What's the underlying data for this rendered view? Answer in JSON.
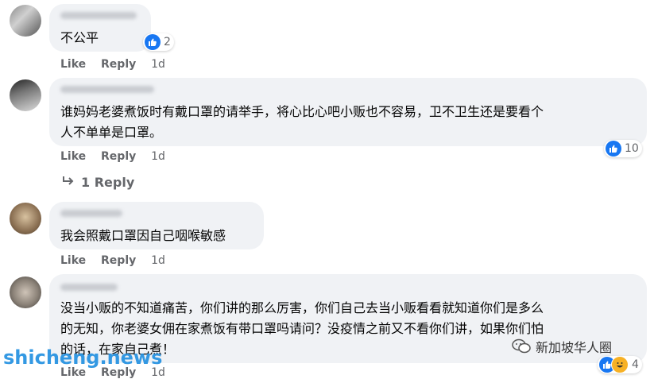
{
  "comments": [
    {
      "text_lines": [
        "不公平"
      ],
      "actions": {
        "like": "Like",
        "reply": "Reply",
        "time": "1d"
      },
      "reactions": "2"
    },
    {
      "text_lines": [
        "谁妈妈老婆煮饭时有戴口罩的请举手，将心比心吧小贩也不容易，卫不卫生还是要看个",
        "人不单单是口罩。"
      ],
      "actions": {
        "like": "Like",
        "reply": "Reply",
        "time": "1d"
      },
      "reactions": "10",
      "replies_label": "1 Reply"
    },
    {
      "text_lines": [
        "我会照戴口罩因自己咽喉敏感"
      ],
      "actions": {
        "like": "Like",
        "reply": "Reply",
        "time": "1d"
      }
    },
    {
      "text_lines": [
        "没当小贩的不知道痛苦，你们讲的那么厉害，你们自己去当小贩看看就知道你们是多么",
        "的无知，你老婆女佣在家煮饭有带口罩吗请问？没疫情之前又不看你们讲，如果你们怕",
        "的话，在家自己煮！"
      ],
      "actions": {
        "like": "Like",
        "reply": "Reply",
        "time": "1d"
      },
      "reactions": "4"
    }
  ],
  "watermark": "shicheng.news",
  "brand": "新加坡华人圈",
  "colors": {
    "bubble": "#f0f2f5",
    "like": "#1877f2",
    "text_secondary": "#65676b",
    "watermark": "#1f8fe0"
  }
}
